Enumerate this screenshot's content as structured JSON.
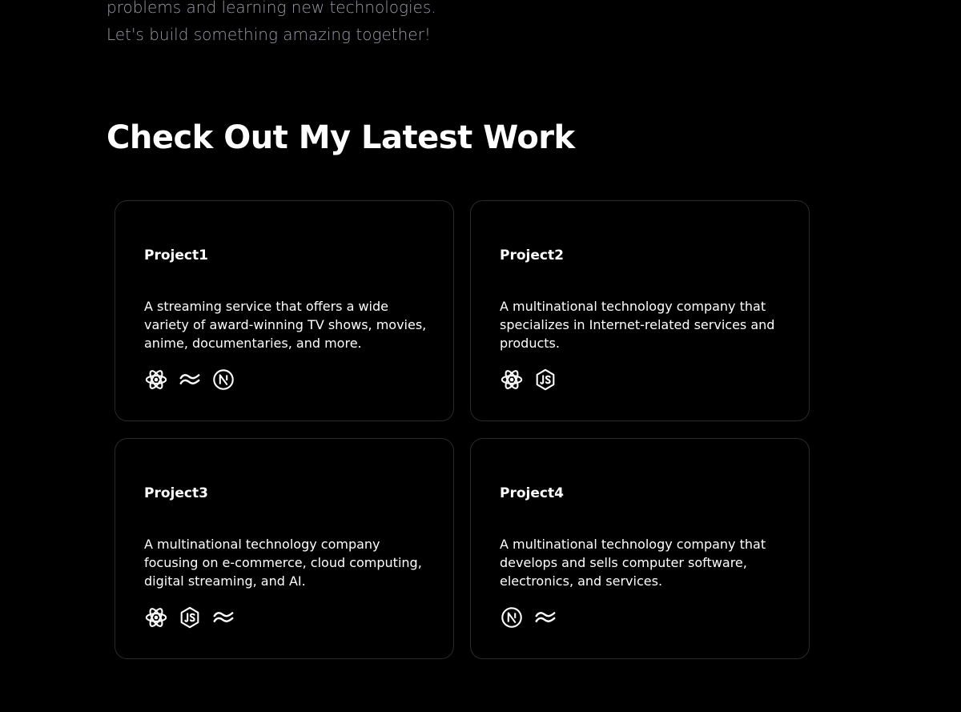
{
  "intro": {
    "line1": "problems and learning new technologies.",
    "line2": "Let's build something amazing together!"
  },
  "section": {
    "title": "Check Out My Latest Work"
  },
  "projects": [
    {
      "title": "Project1",
      "description": "A streaming service that offers a wide variety of award-winning TV shows, movies, anime, documentaries, and more.",
      "tech_icons": [
        "react-icon",
        "tailwind-icon",
        "nextjs-icon"
      ]
    },
    {
      "title": "Project2",
      "description": "A multinational technology company that specializes in Internet-related services and products.",
      "tech_icons": [
        "react-icon",
        "nodejs-icon"
      ]
    },
    {
      "title": "Project3",
      "description": "A multinational technology company focusing on e-commerce, cloud computing, digital streaming, and AI.",
      "tech_icons": [
        "react-icon",
        "nodejs-icon",
        "tailwind-icon"
      ]
    },
    {
      "title": "Project4",
      "description": "A multinational technology company that develops and sells computer software, electronics, and services.",
      "tech_icons": [
        "nextjs-icon",
        "tailwind-icon"
      ]
    }
  ],
  "colors": {
    "background": "#000000",
    "text": "#ffffff",
    "muted_text": "#9a9aa6",
    "card_border": "#2a2a2a"
  }
}
